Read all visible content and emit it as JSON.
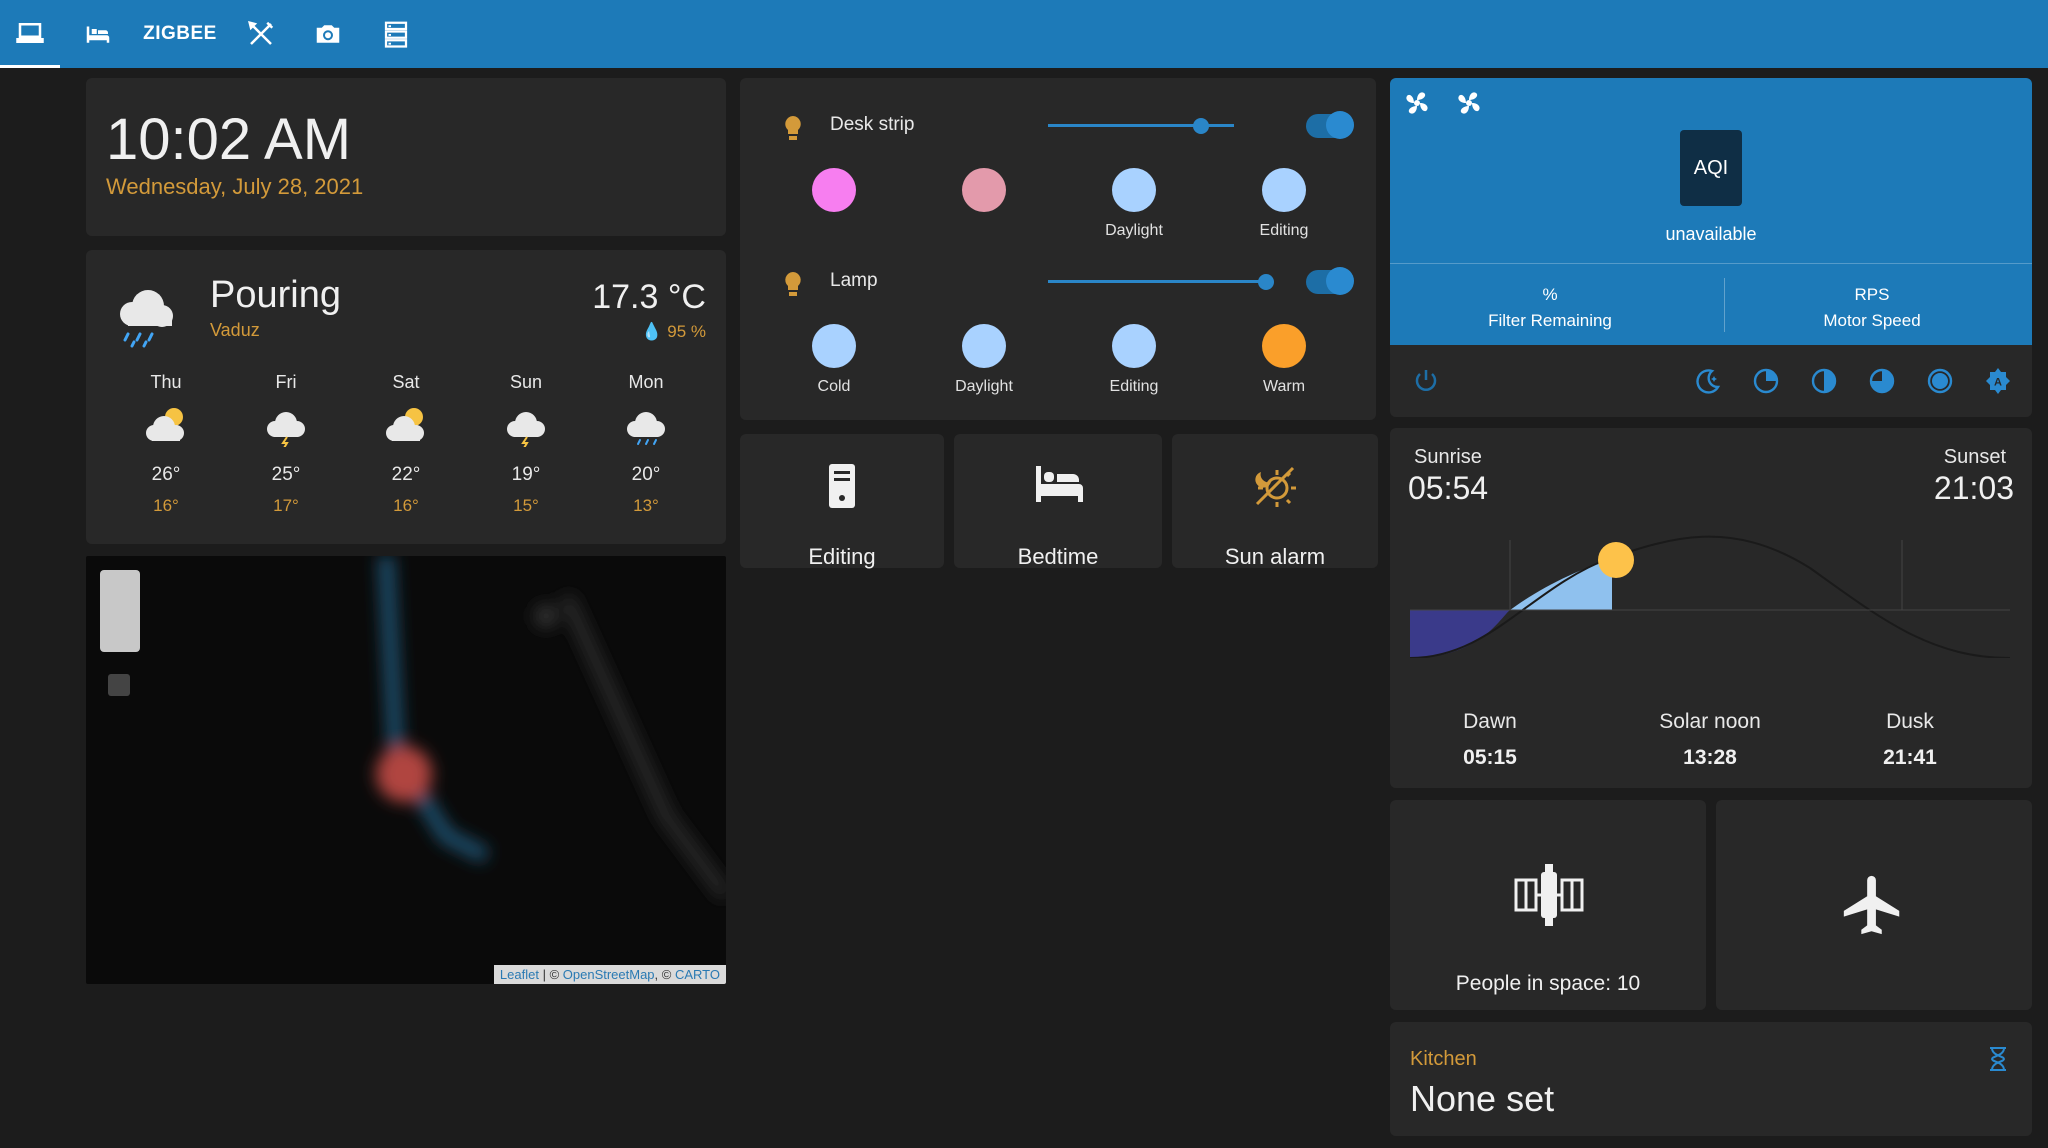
{
  "nav": {
    "tabs": [
      {
        "name": "laptop",
        "icon": "laptop-icon"
      },
      {
        "name": "bed",
        "icon": "bed-icon"
      },
      {
        "name": "zigbee",
        "label": "ZIGBEE"
      },
      {
        "name": "tools",
        "icon": "tools-icon"
      },
      {
        "name": "camera",
        "icon": "camera-icon"
      },
      {
        "name": "server",
        "icon": "server-icon"
      }
    ]
  },
  "clock": {
    "time": "10:02 AM",
    "date": "Wednesday, July 28, 2021"
  },
  "weather": {
    "condition": "Pouring",
    "location": "Vaduz",
    "temperature": "17.3 °C",
    "humidity": "95 %",
    "forecast": [
      {
        "day": "Thu",
        "high": "26°",
        "low": "16°",
        "icon": "partly-cloudy-icon"
      },
      {
        "day": "Fri",
        "high": "25°",
        "low": "17°",
        "icon": "lightning-icon"
      },
      {
        "day": "Sat",
        "high": "22°",
        "low": "16°",
        "icon": "partly-cloudy-icon"
      },
      {
        "day": "Sun",
        "high": "19°",
        "low": "15°",
        "icon": "lightning-icon"
      },
      {
        "day": "Mon",
        "high": "20°",
        "low": "13°",
        "icon": "rain-icon"
      }
    ]
  },
  "map": {
    "attr_leaflet": "Leaflet",
    "attr_rest": " | © ",
    "attr_osm": "OpenStreetMap",
    "attr_sep": ", © ",
    "attr_carto": "CARTO"
  },
  "lights": [
    {
      "name": "Desk strip",
      "brightness": 0.82,
      "on": true,
      "swatches": [
        {
          "color": "#f77ef0",
          "label": ""
        },
        {
          "color": "#e39aab",
          "label": ""
        },
        {
          "color": "#a9d2ff",
          "label": "Daylight"
        },
        {
          "color": "#a9d2ff",
          "label": "Editing"
        }
      ]
    },
    {
      "name": "Lamp",
      "brightness": 0.98,
      "on": true,
      "swatches": [
        {
          "color": "#a9d2ff",
          "label": "Cold"
        },
        {
          "color": "#a9d2ff",
          "label": "Daylight"
        },
        {
          "color": "#a9d2ff",
          "label": "Editing"
        },
        {
          "color": "#fa9f2a",
          "label": "Warm"
        }
      ]
    }
  ],
  "scenes": [
    {
      "label": "Editing",
      "icon": "desktop-tower-icon"
    },
    {
      "label": "Bedtime",
      "icon": "bed-icon"
    },
    {
      "label": "Sun alarm",
      "icon": "sun-alarm-icon"
    }
  ],
  "purifier": {
    "aqi_label": "AQI",
    "status": "unavailable",
    "attrs": [
      {
        "unit": "%",
        "label": "Filter Remaining"
      },
      {
        "unit": "RPS",
        "label": "Motor Speed"
      }
    ]
  },
  "sun": {
    "sunrise_label": "Sunrise",
    "sunrise": "05:54",
    "sunset_label": "Sunset",
    "sunset": "21:03",
    "dawn_label": "Dawn",
    "dawn": "05:15",
    "noon_label": "Solar noon",
    "noon": "13:28",
    "dusk_label": "Dusk",
    "dusk": "21:41"
  },
  "people": {
    "label": "People in space: 10"
  },
  "kitchen": {
    "label": "Kitchen",
    "value": "None set"
  }
}
